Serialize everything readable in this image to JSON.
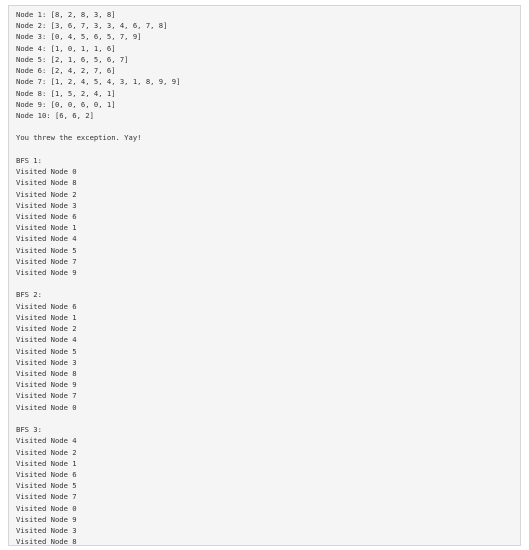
{
  "output": {
    "lines": [
      "Node 1: [8, 2, 8, 3, 8]",
      "Node 2: [3, 6, 7, 3, 3, 4, 6, 7, 8]",
      "Node 3: [0, 4, 5, 6, 5, 7, 9]",
      "Node 4: [1, 0, 1, 1, 6]",
      "Node 5: [2, 1, 6, 5, 6, 7]",
      "Node 6: [2, 4, 2, 7, 6]",
      "Node 7: [1, 2, 4, 5, 4, 3, 1, 8, 9, 9]",
      "Node 8: [1, 5, 2, 4, 1]",
      "Node 9: [0, 0, 6, 0, 1]",
      "Node 10: [6, 6, 2]",
      "",
      "You threw the exception. Yay!",
      "",
      "BFS 1:",
      "Visited Node 0",
      "Visited Node 8",
      "Visited Node 2",
      "Visited Node 3",
      "Visited Node 6",
      "Visited Node 1",
      "Visited Node 4",
      "Visited Node 5",
      "Visited Node 7",
      "Visited Node 9",
      "",
      "BFS 2:",
      "Visited Node 6",
      "Visited Node 1",
      "Visited Node 2",
      "Visited Node 4",
      "Visited Node 5",
      "Visited Node 3",
      "Visited Node 8",
      "Visited Node 9",
      "Visited Node 7",
      "Visited Node 0",
      "",
      "BFS 3:",
      "Visited Node 4",
      "Visited Node 2",
      "Visited Node 1",
      "Visited Node 6",
      "Visited Node 5",
      "Visited Node 7",
      "Visited Node 0",
      "Visited Node 9",
      "Visited Node 3",
      "Visited Node 8"
    ]
  }
}
